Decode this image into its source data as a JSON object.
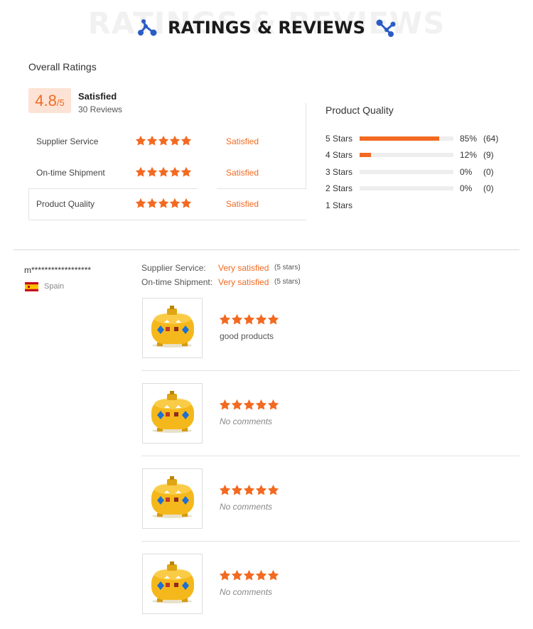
{
  "header": {
    "title": "RATINGS & REVIEWS",
    "watermark": "RATINGS & REVIEWS"
  },
  "overall": {
    "label": "Overall Ratings",
    "score": "4.8",
    "score_max": "/5",
    "summary": "Satisfied",
    "review_count": "30 Reviews",
    "rows": [
      {
        "label": "Supplier Service",
        "stars": 5,
        "status": "Satisfied"
      },
      {
        "label": "On-time Shipment",
        "stars": 5,
        "status": "Satisfied"
      },
      {
        "label": "Product Quality",
        "stars": 5,
        "status": "Satisfied"
      }
    ]
  },
  "product_quality": {
    "title": "Product Quality",
    "rows": [
      {
        "label": "5 Stars",
        "fraction": 0.85,
        "percent": "85%",
        "count": "(64)"
      },
      {
        "label": "4 Stars",
        "fraction": 0.12,
        "percent": "12%",
        "count": "(9)"
      },
      {
        "label": "3 Stars",
        "fraction": 0,
        "percent": "0%",
        "count": "(0)"
      },
      {
        "label": "2 Stars",
        "fraction": 0,
        "percent": "0%",
        "count": "(0)"
      },
      {
        "label": "1 Stars"
      }
    ]
  },
  "review": {
    "reviewer": "m******************",
    "country": "Spain",
    "supplier_service_label": "Supplier Service:",
    "supplier_service_value": "Very satisfied",
    "supplier_service_stars": "(5 stars)",
    "shipment_label": "On-time Shipment:",
    "shipment_value": "Very satisfied",
    "shipment_stars": "(5 stars)",
    "items": [
      {
        "stars": 5,
        "comment": "good products"
      },
      {
        "stars": 5,
        "comment": "No comments"
      },
      {
        "stars": 5,
        "comment": "No comments"
      },
      {
        "stars": 5,
        "comment": "No comments"
      }
    ]
  },
  "colors": {
    "accent": "#f26a21",
    "score_bg": "#fde3d5",
    "bar_track": "#eeeeee",
    "divider": "#e3e3e3",
    "header_icon": "#2b5cc4"
  },
  "icons": {
    "header_left": "molecule-icon",
    "header_right": "molecule-icon",
    "star": "star-icon",
    "flag": "spain-flag-icon",
    "product": "yellow-tank-thumbnail"
  }
}
